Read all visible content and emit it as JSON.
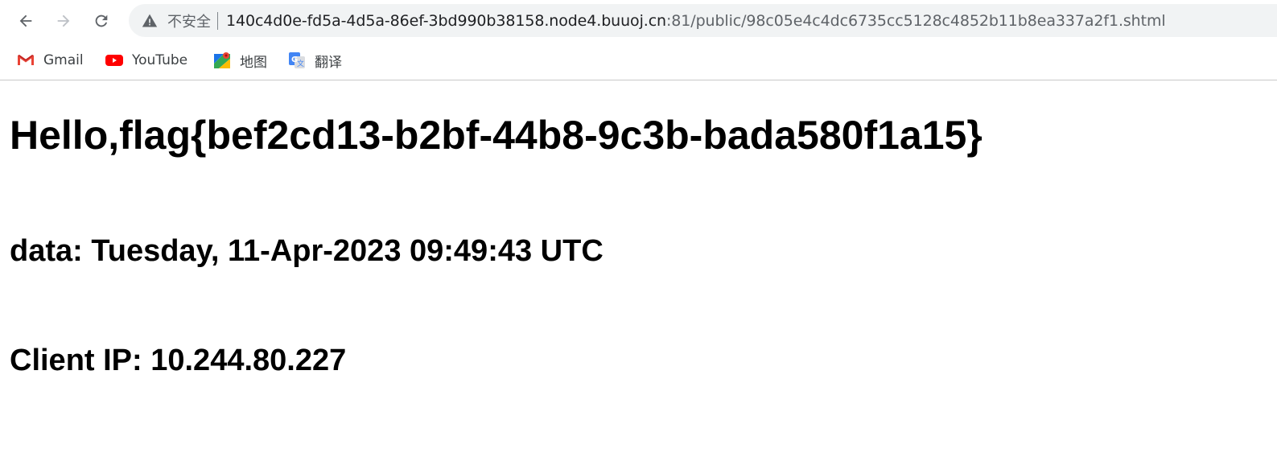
{
  "browser": {
    "security_label": "不安全",
    "url_host": "140c4d0e-fd5a-4d5a-86ef-3bd990b38158.node4.buuoj.cn",
    "url_path": ":81/public/98c05e4c4dc6735cc5128c4852b11b8ea337a2f1.shtml",
    "icons": {
      "back": "back-arrow-icon",
      "forward": "forward-arrow-icon",
      "reload": "reload-icon",
      "security": "warning-triangle-icon"
    }
  },
  "bookmarks": [
    {
      "label": "Gmail",
      "icon": "gmail-icon"
    },
    {
      "label": "YouTube",
      "icon": "youtube-icon"
    },
    {
      "label": "地图",
      "icon": "maps-icon"
    },
    {
      "label": "翻译",
      "icon": "translate-icon"
    }
  ],
  "page": {
    "greeting": "Hello,flag{bef2cd13-b2bf-44b8-9c3b-bada580f1a15}",
    "date_line": "data: Tuesday, 11-Apr-2023 09:49:43 UTC",
    "ip_line": "Client IP: 10.244.80.227"
  }
}
